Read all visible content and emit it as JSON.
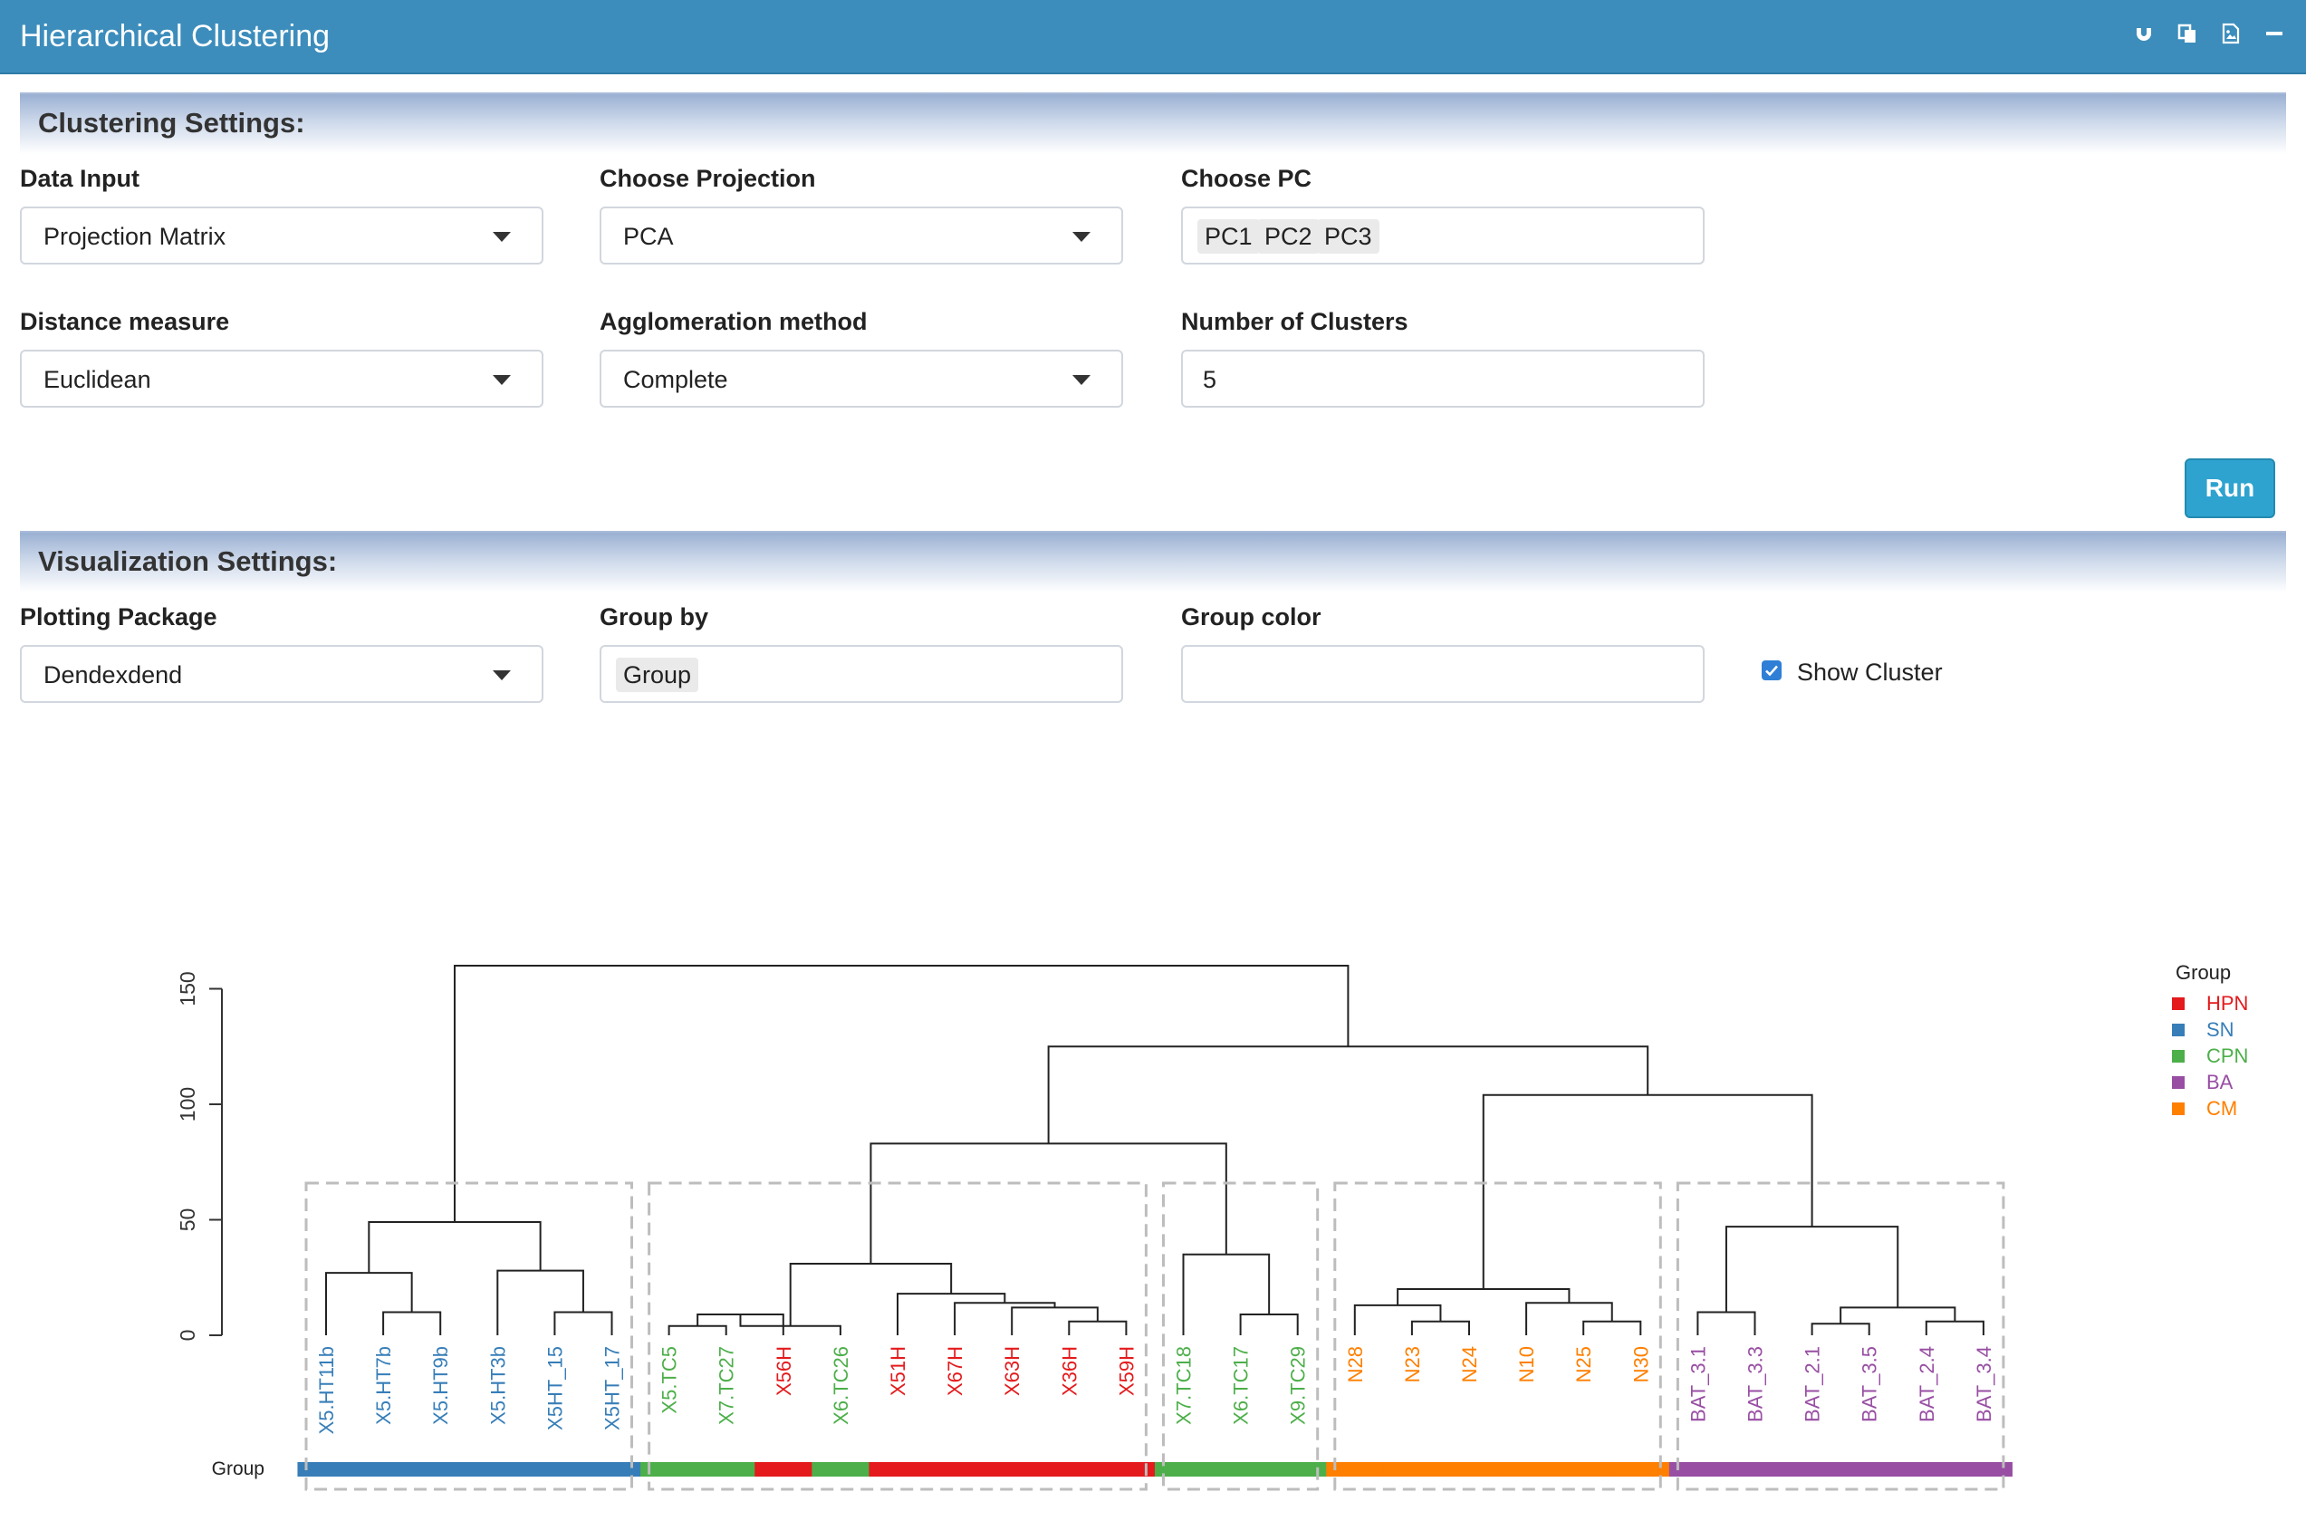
{
  "header": {
    "title": "Hierarchical Clustering"
  },
  "tools": [
    "magnet-icon",
    "copy-icon",
    "image-icon",
    "minimize-icon"
  ],
  "clustering_settings": {
    "title": "Clustering Settings:",
    "data_input": {
      "label": "Data Input",
      "value": "Projection Matrix"
    },
    "projection": {
      "label": "Choose Projection",
      "value": "PCA"
    },
    "pc": {
      "label": "Choose PC",
      "values": [
        "PC1",
        "PC2",
        "PC3"
      ]
    },
    "distance": {
      "label": "Distance measure",
      "value": "Euclidean"
    },
    "agglomeration": {
      "label": "Agglomeration method",
      "value": "Complete"
    },
    "clusters": {
      "label": "Number of Clusters",
      "value": "5"
    },
    "run_label": "Run"
  },
  "visualization_settings": {
    "title": "Visualization Settings:",
    "package": {
      "label": "Plotting Package",
      "value": "Dendexdend"
    },
    "group_by": {
      "label": "Group by",
      "value": "Group"
    },
    "group_color": {
      "label": "Group color",
      "value": ""
    },
    "show_cluster": {
      "label": "Show Cluster",
      "checked": true
    }
  },
  "colors": {
    "header": "#3c8dbc",
    "HPN": "#e41a1c",
    "SN": "#377eb8",
    "CPN": "#4daf4a",
    "BA": "#984ea3",
    "CM": "#ff7f00",
    "run_button": "#2ea3cf",
    "cluster_box": "#bdbdbd"
  },
  "chart_data": {
    "type": "dendrogram",
    "ylim": [
      0,
      160
    ],
    "yticks": [
      0,
      50,
      100,
      150
    ],
    "bar_label": "Group",
    "legend": {
      "title": "Group",
      "placement": "right",
      "items": [
        {
          "label": "HPN",
          "color": "#e41a1c"
        },
        {
          "label": "SN",
          "color": "#377eb8"
        },
        {
          "label": "CPN",
          "color": "#4daf4a"
        },
        {
          "label": "BA",
          "color": "#984ea3"
        },
        {
          "label": "CM",
          "color": "#ff7f00"
        }
      ]
    },
    "leaves": [
      {
        "label": "X5.HT11b",
        "group": "SN"
      },
      {
        "label": "X5.HT7b",
        "group": "SN"
      },
      {
        "label": "X5.HT9b",
        "group": "SN"
      },
      {
        "label": "X5.HT3b",
        "group": "SN"
      },
      {
        "label": "X5HT_15",
        "group": "SN"
      },
      {
        "label": "X5HT_17",
        "group": "SN"
      },
      {
        "label": "X5.TC5",
        "group": "CPN"
      },
      {
        "label": "X7.TC27",
        "group": "CPN"
      },
      {
        "label": "X56H",
        "group": "HPN"
      },
      {
        "label": "X6.TC26",
        "group": "CPN"
      },
      {
        "label": "X51H",
        "group": "HPN"
      },
      {
        "label": "X67H",
        "group": "HPN"
      },
      {
        "label": "X63H",
        "group": "HPN"
      },
      {
        "label": "X36H",
        "group": "HPN"
      },
      {
        "label": "X59H",
        "group": "HPN"
      },
      {
        "label": "X7.TC18",
        "group": "CPN"
      },
      {
        "label": "X6.TC17",
        "group": "CPN"
      },
      {
        "label": "X9.TC29",
        "group": "CPN"
      },
      {
        "label": "N28",
        "group": "CM"
      },
      {
        "label": "N23",
        "group": "CM"
      },
      {
        "label": "N24",
        "group": "CM"
      },
      {
        "label": "N10",
        "group": "CM"
      },
      {
        "label": "N25",
        "group": "CM"
      },
      {
        "label": "N30",
        "group": "CM"
      },
      {
        "label": "BAT_3.1",
        "group": "BA"
      },
      {
        "label": "BAT_3.3",
        "group": "BA"
      },
      {
        "label": "BAT_2.1",
        "group": "BA"
      },
      {
        "label": "BAT_3.5",
        "group": "BA"
      },
      {
        "label": "BAT_2.4",
        "group": "BA"
      },
      {
        "label": "BAT_3.4",
        "group": "BA"
      }
    ],
    "merges": [
      {
        "a": "L1",
        "b": "L2",
        "h": 10
      },
      {
        "a": "L0",
        "b": "M0",
        "h": 27
      },
      {
        "a": "L4",
        "b": "L5",
        "h": 10
      },
      {
        "a": "L3",
        "b": "M2",
        "h": 28
      },
      {
        "a": "M1",
        "b": "M3",
        "h": 49
      },
      {
        "a": "L6",
        "b": "L7",
        "h": 4
      },
      {
        "a": "M5",
        "b": "L8",
        "h": 9
      },
      {
        "a": "M6",
        "b": "L9",
        "h": 4
      },
      {
        "a": "L13",
        "b": "L14",
        "h": 6
      },
      {
        "a": "L12",
        "b": "M8",
        "h": 12
      },
      {
        "a": "L11",
        "b": "M9",
        "h": 14
      },
      {
        "a": "L10",
        "b": "M10",
        "h": 18
      },
      {
        "a": "M7",
        "b": "M11",
        "h": 31
      },
      {
        "a": "L16",
        "b": "L17",
        "h": 9
      },
      {
        "a": "L15",
        "b": "M13",
        "h": 35
      },
      {
        "a": "M12",
        "b": "M14",
        "h": 83
      },
      {
        "a": "L19",
        "b": "L20",
        "h": 6
      },
      {
        "a": "L18",
        "b": "M16",
        "h": 13
      },
      {
        "a": "L22",
        "b": "L23",
        "h": 6
      },
      {
        "a": "L21",
        "b": "M18",
        "h": 14
      },
      {
        "a": "M17",
        "b": "M19",
        "h": 20
      },
      {
        "a": "L24",
        "b": "L25",
        "h": 10
      },
      {
        "a": "L26",
        "b": "L27",
        "h": 5
      },
      {
        "a": "L28",
        "b": "L29",
        "h": 6
      },
      {
        "a": "M22",
        "b": "M23",
        "h": 12
      },
      {
        "a": "M21",
        "b": "M24",
        "h": 47
      },
      {
        "a": "M20",
        "b": "M25",
        "h": 104
      },
      {
        "a": "M15",
        "b": "M26",
        "h": 125
      },
      {
        "a": "M4",
        "b": "M27",
        "h": 160
      }
    ],
    "clusters": [
      [
        0,
        5
      ],
      [
        6,
        14
      ],
      [
        15,
        17
      ],
      [
        18,
        23
      ],
      [
        24,
        29
      ]
    ]
  }
}
